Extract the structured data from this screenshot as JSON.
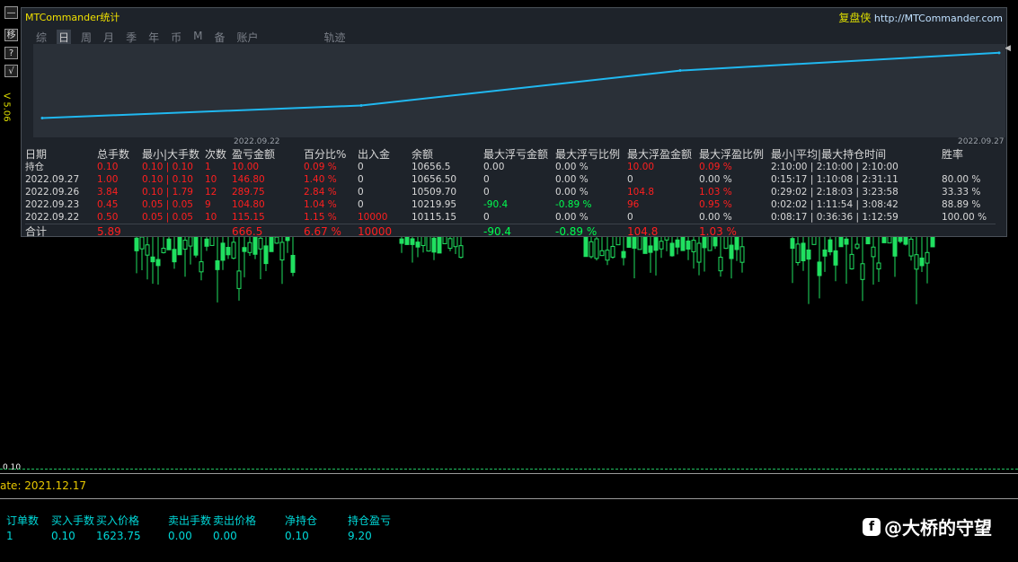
{
  "app": {
    "title": "MTCommander统计",
    "site_cn": "复盘侠",
    "site_url": "http://MTCommander.com"
  },
  "toolbar": {
    "btn1": "—",
    "btn2": "移",
    "btn3": "?",
    "btn4": "√",
    "version": "V 5.06"
  },
  "tabs": [
    "综",
    "日",
    "周",
    "月",
    "季",
    "年",
    "币",
    "M",
    "备",
    "账户",
    "轨迹"
  ],
  "active_tab": "日",
  "chart_data": {
    "type": "line",
    "x": [
      "2022.09.22",
      "2022.09.23",
      "2022.09.26",
      "2022.09.27"
    ],
    "values": [
      10115.15,
      10219.95,
      10509.7,
      10656.5
    ],
    "x_tick_labels": [
      "2022.09.22",
      "2022.09.27"
    ],
    "line_color": "#20b8f0",
    "background": "#2a3038"
  },
  "table": {
    "headers": [
      "日期",
      "总手数",
      "最小|大手数",
      "次数",
      "盈亏金额",
      "百分比%",
      "出入金",
      "余额",
      "最大浮亏金额",
      "最大浮亏比例",
      "最大浮盈金额",
      "最大浮盈比例",
      "最小|平均|最大持仓时间",
      "胜率"
    ],
    "rows": [
      [
        "持仓",
        "0.10",
        "0.10 | 0.10",
        "1",
        "10.00",
        "0.09 %",
        "0",
        "10656.5",
        "0.00",
        "0.00 %",
        "10.00",
        "0.09 %",
        "2:10:00 | 2:10:00 | 2:10:00",
        ""
      ],
      [
        "2022.09.27",
        "1.00",
        "0.10 | 0.10",
        "10",
        "146.80",
        "1.40 %",
        "0",
        "10656.50",
        "0",
        "0.00 %",
        "0",
        "0.00 %",
        "0:15:17 | 1:10:08 | 2:31:11",
        "80.00 %"
      ],
      [
        "2022.09.26",
        "3.84",
        "0.10 | 1.79",
        "12",
        "289.75",
        "2.84 %",
        "0",
        "10509.70",
        "0",
        "0.00 %",
        "104.8",
        "1.03 %",
        "0:29:02 | 2:18:03 | 3:23:58",
        "33.33 %"
      ],
      [
        "2022.09.23",
        "0.45",
        "0.05 | 0.05",
        "9",
        "104.80",
        "1.04 %",
        "0",
        "10219.95",
        "-90.4",
        "-0.89 %",
        "96",
        "0.95 %",
        "0:02:02 | 1:11:54 | 3:08:42",
        "88.89 %"
      ],
      [
        "2022.09.22",
        "0.50",
        "0.05 | 0.05",
        "10",
        "115.15",
        "1.15 %",
        "10000",
        "10115.15",
        "0",
        "0.00 %",
        "0",
        "0.00 %",
        "0:08:17 | 0:36:36 | 1:12:59",
        "100.00 %"
      ]
    ],
    "total": [
      "合计",
      "5.89",
      "",
      "",
      "666.5",
      "6.67 %",
      "10000",
      "",
      "-90.4",
      "-0.89 %",
      "104.8",
      "1.03 %",
      "",
      ""
    ]
  },
  "colors": {
    "profit_red": "#ff1f1f",
    "loss_green": "#00ff50",
    "candle_green": "#20e060"
  },
  "price_level": "0.10",
  "date_line": "ate: 2021.12.17",
  "positions": {
    "labels": [
      "订单数",
      "买入手数",
      "买入价格",
      "卖出手数",
      "卖出价格",
      "净持仓",
      "持仓盈亏"
    ],
    "values": [
      "1",
      "0.10",
      "1623.75",
      "0.00",
      "0.00",
      "0.10",
      "9.20"
    ]
  },
  "watermark": "@大桥的守望"
}
